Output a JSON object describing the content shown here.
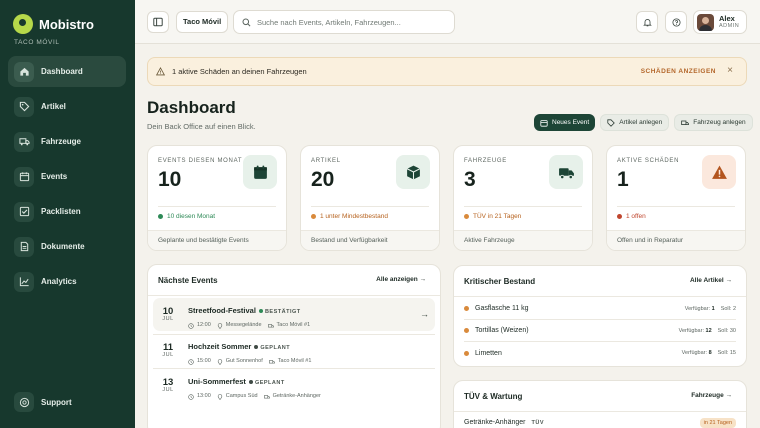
{
  "brand": {
    "name": "Mobistro",
    "subtitle": "TACO MÓVIL"
  },
  "sidebar": {
    "items": [
      {
        "label": "Dashboard",
        "icon": "home-icon",
        "active": true
      },
      {
        "label": "Artikel",
        "icon": "tag-icon",
        "active": false
      },
      {
        "label": "Fahrzeuge",
        "icon": "truck-icon",
        "active": false
      },
      {
        "label": "Events",
        "icon": "calendar-icon",
        "active": false
      },
      {
        "label": "Packlisten",
        "icon": "checklist-icon",
        "active": false
      },
      {
        "label": "Dokumente",
        "icon": "document-icon",
        "active": false
      },
      {
        "label": "Analytics",
        "icon": "chart-icon",
        "active": false
      }
    ],
    "support": "Support"
  },
  "topbar": {
    "location": "Taco Móvil",
    "search_placeholder": "Suche nach Events, Artikeln, Fahrzeugen...",
    "user": {
      "name": "Alex",
      "role": "ADMIN"
    }
  },
  "alert": {
    "text": "1 aktive Schäden an deinen Fahrzeugen",
    "action": "SCHÄDEN ANZEIGEN",
    "close": "×"
  },
  "header": {
    "title": "Dashboard",
    "subtitle": "Dein Back Office auf einen Blick.",
    "actions": [
      {
        "label": "Neues Event",
        "icon": "calendar-icon"
      },
      {
        "label": "Artikel anlegen",
        "icon": "tag-icon"
      },
      {
        "label": "Fahrzeug anlegen",
        "icon": "truck-icon"
      }
    ]
  },
  "stats": [
    {
      "label": "EVENTS DIESEN MONAT",
      "value": "10",
      "note": "10 diesen Monat",
      "note_color": "#2e8a57",
      "foot": "Geplante und bestätigte Events",
      "icon": "calendar-icon",
      "icon_bg": "#e7f1ea",
      "icon_color": "#1d4536"
    },
    {
      "label": "ARTIKEL",
      "value": "20",
      "note": "1 unter Mindestbestand",
      "note_color": "#b6621e",
      "foot": "Bestand und Verfügbarkeit",
      "icon": "box-icon",
      "icon_bg": "#e7f1ea",
      "icon_color": "#1d4536"
    },
    {
      "label": "FAHRZEUGE",
      "value": "3",
      "note": "TÜV in 21 Tagen",
      "note_color": "#b6621e",
      "foot": "Aktive Fahrzeuge",
      "icon": "truck-icon",
      "icon_bg": "#e7f1ea",
      "icon_color": "#1d4536"
    },
    {
      "label": "AKTIVE SCHÄDEN",
      "value": "1",
      "note": "1 offen",
      "note_color": "#c0462e",
      "foot": "Offen und in Reparatur",
      "icon": "warning-icon",
      "icon_bg": "#fbe8dd",
      "icon_color": "#b3541e"
    }
  ],
  "events": {
    "title": "Nächste Events",
    "link": "Alle anzeigen →",
    "items": [
      {
        "day": "10",
        "month": "JUL",
        "name": "Streetfood-Festival",
        "status": "BESTÄTIGT",
        "status_color": "#2e8a57",
        "time": "12:00",
        "place": "Messegelände",
        "vehicle": "Taco Móvil #1"
      },
      {
        "day": "11",
        "month": "JUL",
        "name": "Hochzeit Sommer",
        "status": "GEPLANT",
        "status_color": "#3f4a44",
        "time": "15:00",
        "place": "Gut Sonnenhof",
        "vehicle": "Taco Móvil #1"
      },
      {
        "day": "13",
        "month": "JUL",
        "name": "Uni-Sommerfest",
        "status": "GEPLANT",
        "status_color": "#3f4a44",
        "time": "13:00",
        "place": "Campus Süd",
        "vehicle": "Getränke-Anhänger"
      }
    ]
  },
  "stock": {
    "title": "Kritischer Bestand",
    "link": "Alle Artikel →",
    "avail_label": "Verfügbar:",
    "target_label": "Soll:",
    "items": [
      {
        "name": "Gasflasche 11 kg",
        "available": "1",
        "target": "2"
      },
      {
        "name": "Tortillas (Weizen)",
        "available": "12",
        "target": "30"
      },
      {
        "name": "Limetten",
        "available": "8",
        "target": "15"
      }
    ]
  },
  "tuev": {
    "title": "TÜV & Wartung",
    "link": "Fahrzeuge →",
    "items": [
      {
        "name": "Getränke-Anhänger",
        "type": "TÜV",
        "due": "in 21 Tagen"
      }
    ]
  }
}
